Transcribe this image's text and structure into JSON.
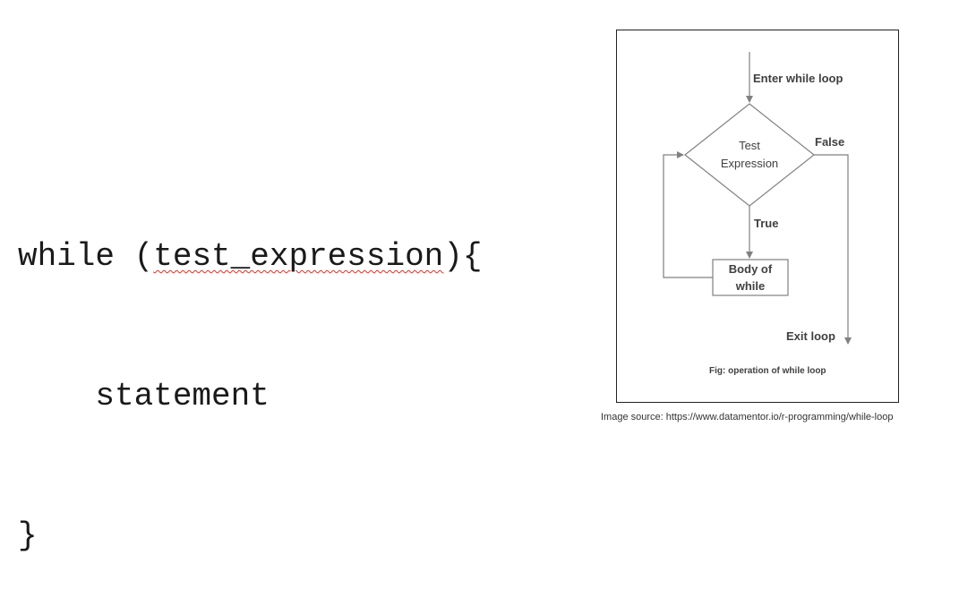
{
  "code": {
    "line1_prefix": "while (",
    "line1_condition": "test_expression",
    "line1_suffix": "){",
    "line2": "    statement",
    "line3": "}"
  },
  "flowchart": {
    "enter_label": "Enter while loop",
    "decision_line1": "Test",
    "decision_line2": "Expression",
    "false_label": "False",
    "true_label": "True",
    "body_line1": "Body of",
    "body_line2": "while",
    "exit_label": "Exit loop",
    "caption": "Fig: operation of while loop",
    "line_color": "#808080"
  },
  "source": {
    "text": "Image source: https://www.datamentor.io/r-programming/while-loop"
  }
}
